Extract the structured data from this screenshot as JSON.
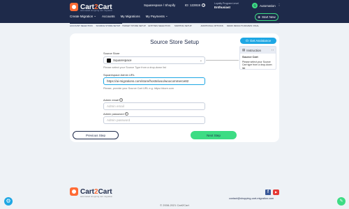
{
  "header": {
    "logo_main": "Cart",
    "logo_accent": "2",
    "logo_end": "Cart",
    "logo_sub": "automated shopping cart migration",
    "route": "Squarespace / Shopify",
    "counter": "ID: 122819",
    "loyalty_line1": "Loyalty Program Level",
    "loyalty_level": "Enthusiast",
    "avatar_initial": "Q",
    "user_name": "Automation",
    "nav": [
      "Create Migration",
      "Accounts",
      "My Migrations",
      "My Payments"
    ],
    "start_new": "Start New"
  },
  "steps": [
    "Account Selection",
    "Source Store Setup",
    "Target Store Setup",
    "Entities Selection",
    "Mapping Setup",
    "Additional Options",
    "Demo Results Review",
    "Final"
  ],
  "card": {
    "title": "Source Store Setup",
    "get_assistance": "Get Assistance",
    "source_store_label": "Source Store",
    "source_store_value": "Squarespace",
    "source_store_hint": "Please select your Source Type from a drop-down list",
    "admin_url_label": "Squarespace Admin URL",
    "admin_url_value": "https://ai-migrations.com/store/hosts/woo/woocommerce82",
    "admin_url_hint": "Please, provide your Source Cart URL e.g. https://store.com",
    "admin_email_label": "Admin email",
    "admin_email_placeholder": "Admin email",
    "admin_password_label": "Admin password",
    "admin_password_placeholder": "Admin password",
    "previous_step": "Previous Step",
    "next_step": "Next Step"
  },
  "instruction": {
    "title": "Instruction",
    "body_title": "Source Cart",
    "body_text": "Please select your Source Cart type from a drop-down list"
  },
  "footer": {
    "logo_sub": "automated shopping cart migration",
    "contact": "contact@shopping-cart-migration.com",
    "copyright": "© 2008-2021 Cart2Cart"
  }
}
